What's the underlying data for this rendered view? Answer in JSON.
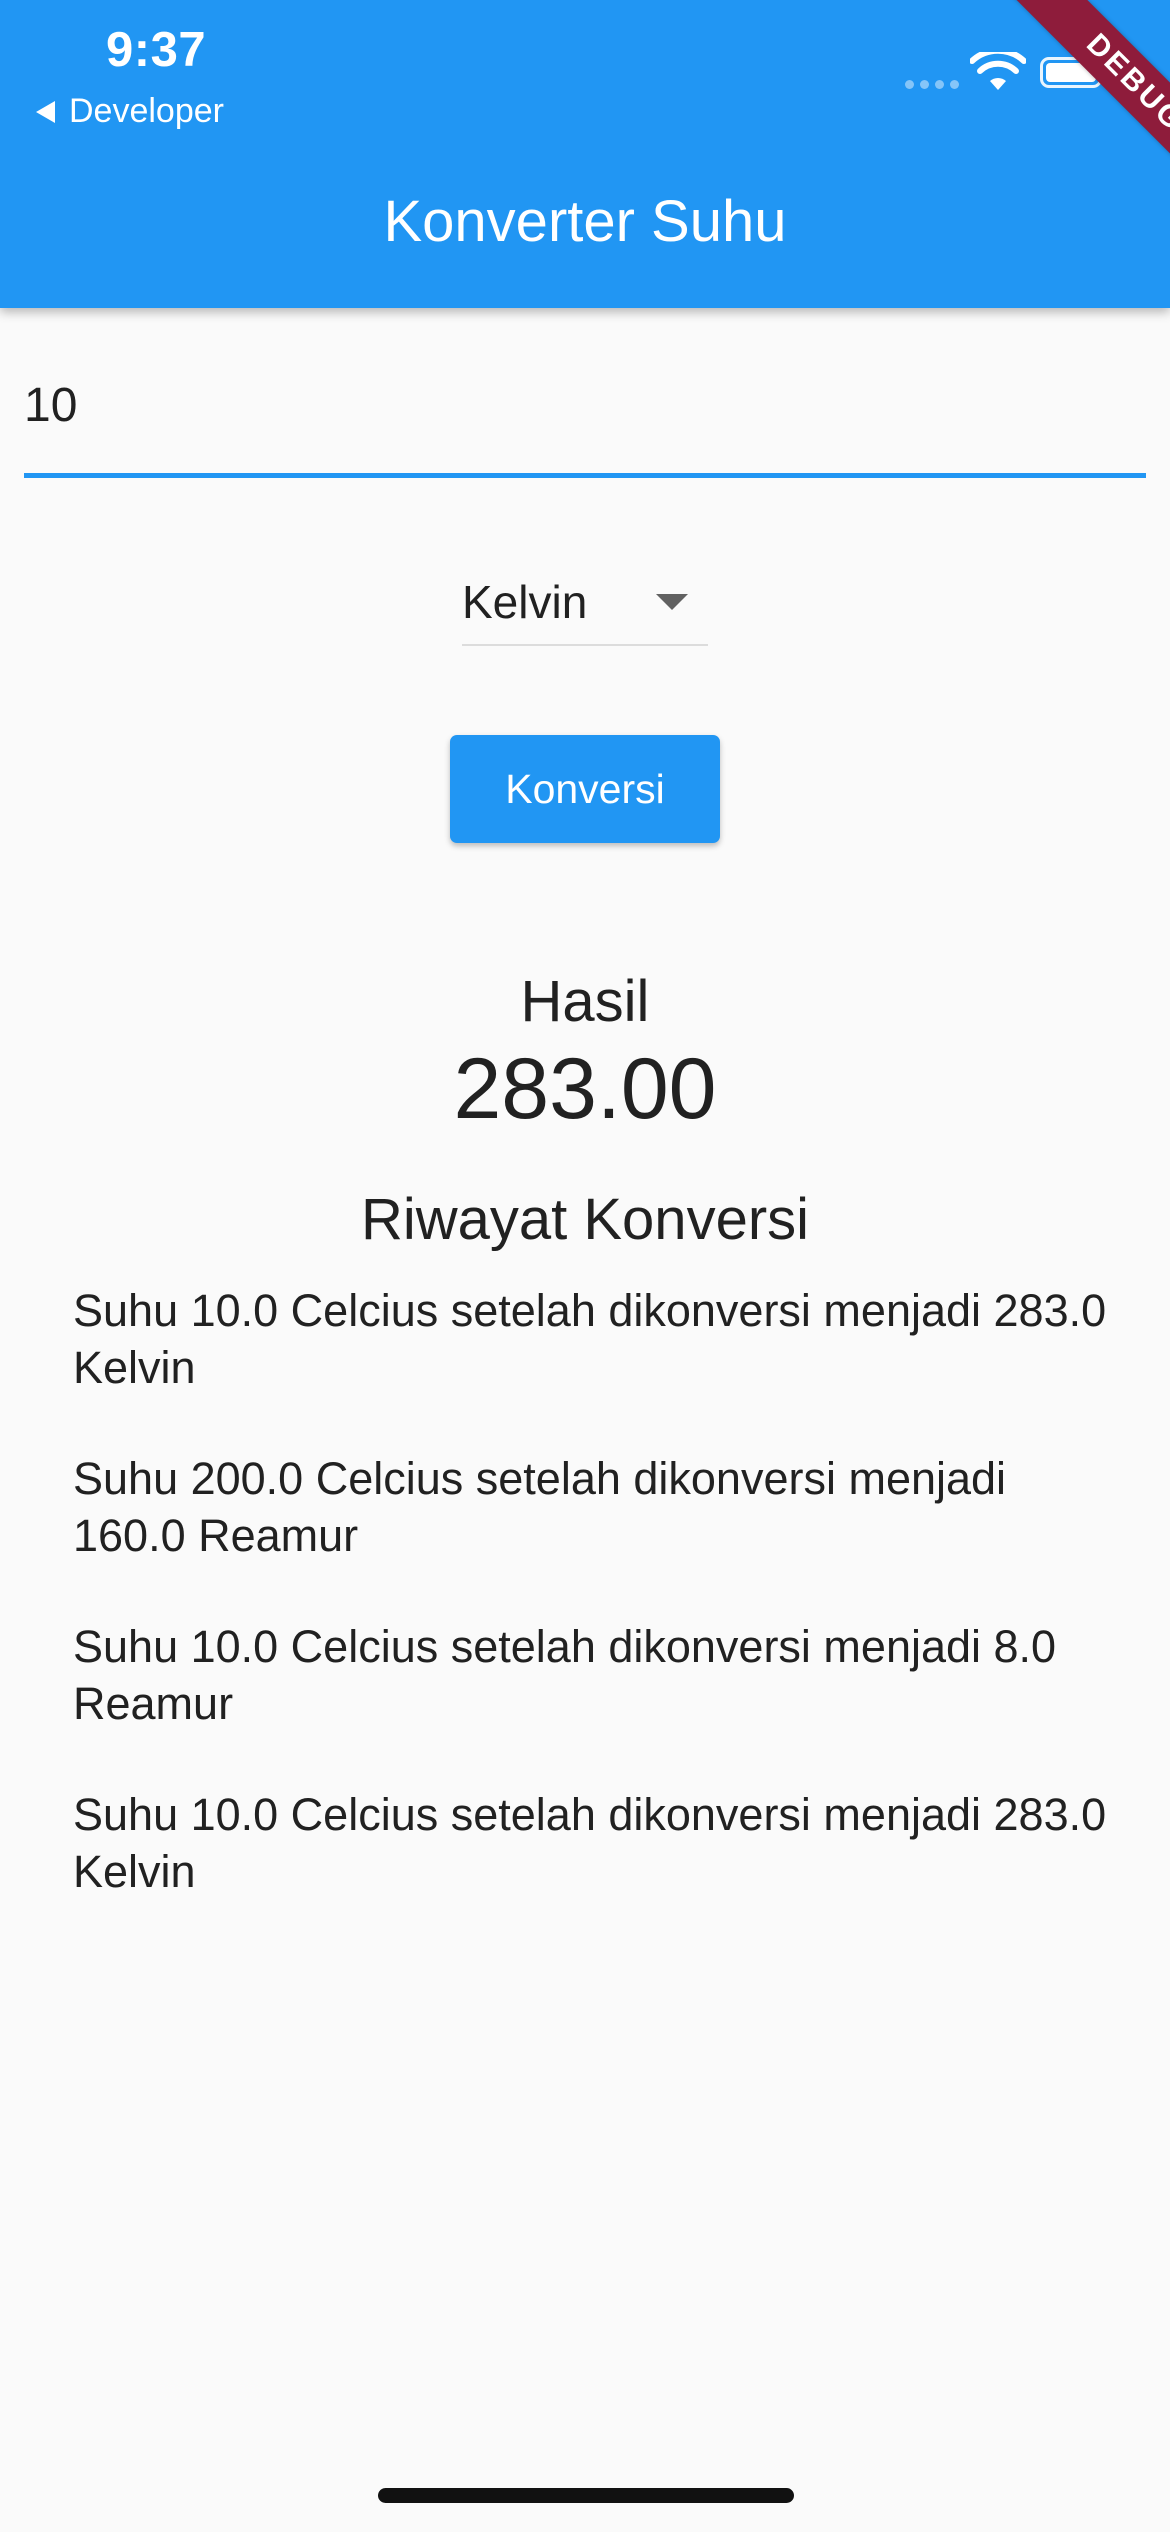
{
  "status_bar": {
    "time": "9:37",
    "back_label": "Developer"
  },
  "debug_banner": "DEBUG",
  "app_bar": {
    "title": "Konverter Suhu"
  },
  "input": {
    "value": "10"
  },
  "dropdown": {
    "selected": "Kelvin"
  },
  "convert_button": {
    "label": "Konversi"
  },
  "result": {
    "label": "Hasil",
    "value": "283.00"
  },
  "history": {
    "title": "Riwayat Konversi",
    "items": [
      "Suhu 10.0 Celcius setelah dikonversi menjadi 283.0 Kelvin",
      "Suhu 200.0 Celcius setelah dikonversi menjadi 160.0 Reamur",
      "Suhu 10.0 Celcius setelah dikonversi menjadi 8.0 Reamur",
      "Suhu 10.0 Celcius setelah dikonversi menjadi 283.0 Kelvin"
    ]
  },
  "colors": {
    "primary": "#2196f3",
    "background": "#fafafa",
    "text": "#212121",
    "debug_banner": "#8e1c3b"
  },
  "icons": {
    "back": "back-arrow-icon",
    "signal": "signal-icon",
    "wifi": "wifi-icon",
    "battery": "battery-icon",
    "dropdown": "dropdown-arrow-icon"
  }
}
